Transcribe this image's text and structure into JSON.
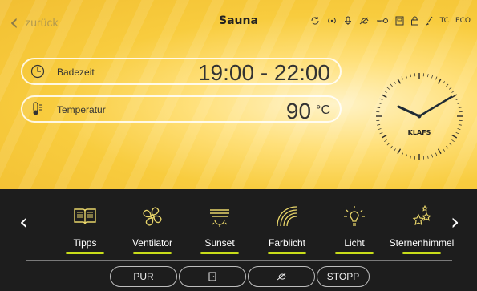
{
  "header": {
    "back_label": "zurück",
    "title": "Sauna",
    "status_icons": [
      "sync-icon",
      "broadcast-icon",
      "microphone-icon",
      "fan-icon",
      "key-icon",
      "door-icon",
      "lock-icon",
      "brush-icon"
    ],
    "status_texts": [
      "TC",
      "ECO"
    ]
  },
  "bathing_time": {
    "label": "Badezeit",
    "value": "19:00 - 22:00"
  },
  "temperature": {
    "label": "Temperatur",
    "value": "90",
    "unit": "°C"
  },
  "clock": {
    "brand": "KLAFS"
  },
  "functions": [
    {
      "label": "Tipps"
    },
    {
      "label": "Ventilator"
    },
    {
      "label": "Sunset"
    },
    {
      "label": "Farblicht"
    },
    {
      "label": "Licht"
    },
    {
      "label": "Sternenhimmel"
    }
  ],
  "bottom_buttons": {
    "pur": "PUR",
    "door": "",
    "fan": "",
    "stopp": "STOPP"
  },
  "colors": {
    "accent": "#c8dd1a",
    "top_bg": "#f5c73a",
    "bottom_bg": "#1d1d1d"
  }
}
